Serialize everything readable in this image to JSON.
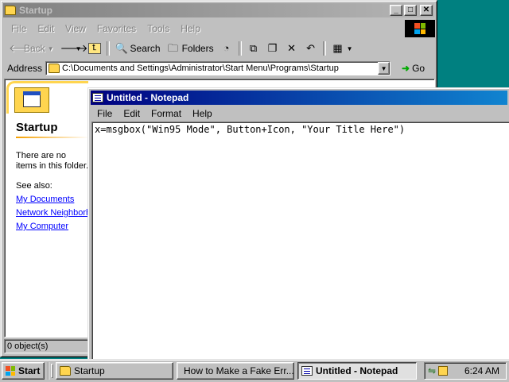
{
  "explorer": {
    "title": "Startup",
    "menu": [
      "File",
      "Edit",
      "View",
      "Favorites",
      "Tools",
      "Help"
    ],
    "toolbar": {
      "back": "Back",
      "search": "Search",
      "folders": "Folders"
    },
    "address_label": "Address",
    "address_value": "C:\\Documents and Settings\\Administrator\\Start Menu\\Programs\\Startup",
    "go_label": "Go",
    "panel": {
      "heading": "Startup",
      "message": "There are no items in this folder.",
      "see_also": "See also:",
      "links": [
        "My Documents",
        "Network Neighborhood",
        "My Computer"
      ]
    },
    "status": "0 object(s)"
  },
  "notepad": {
    "title": "Untitled - Notepad",
    "menu": [
      "File",
      "Edit",
      "Format",
      "Help"
    ],
    "content": "x=msgbox(\"Win95 Mode\", Button+Icon, \"Your Title Here\")"
  },
  "taskbar": {
    "start_label": "Start",
    "tasks": [
      "Startup",
      "How to Make a Fake Err...",
      "Untitled - Notepad"
    ],
    "clock": "6:24 AM"
  }
}
